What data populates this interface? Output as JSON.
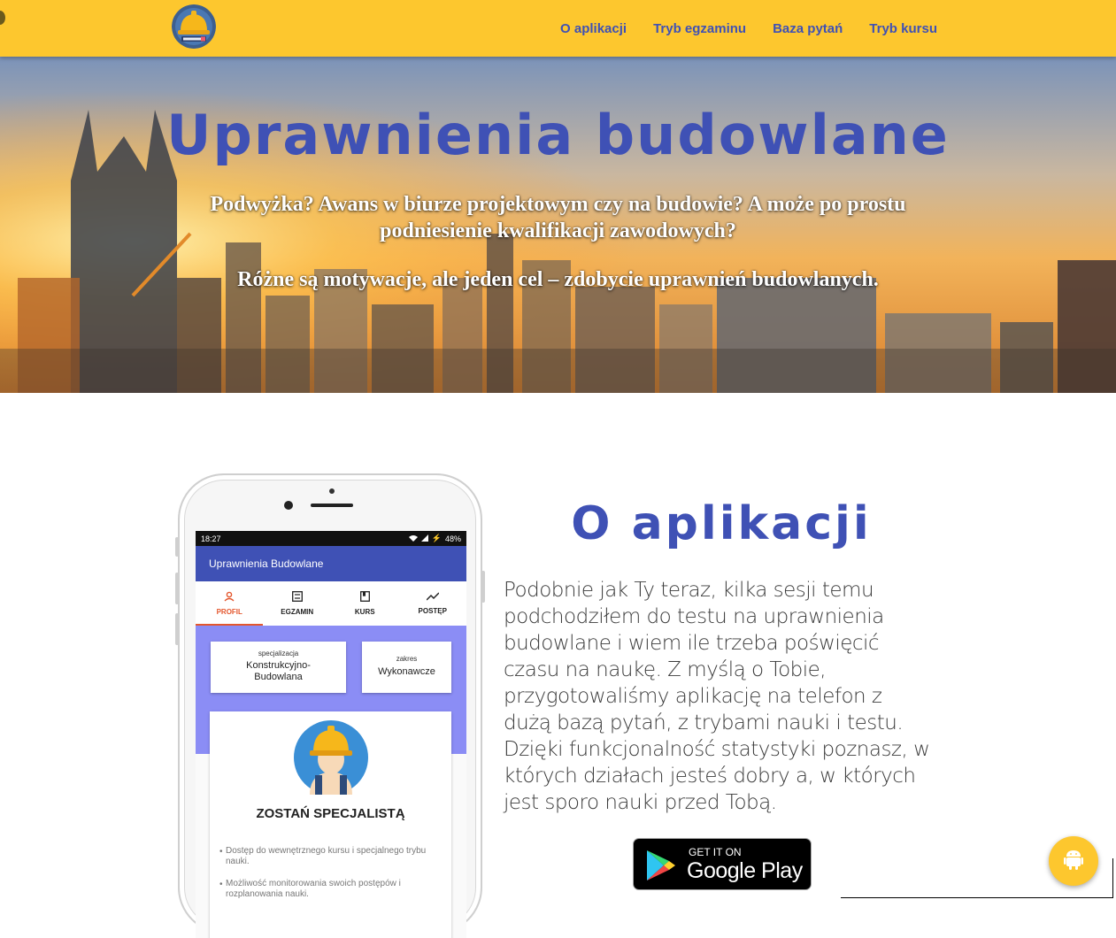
{
  "nav": {
    "items": [
      {
        "label": "O aplikacji"
      },
      {
        "label": "Tryb egzaminu"
      },
      {
        "label": "Baza pytań"
      },
      {
        "label": "Tryb kursu"
      }
    ]
  },
  "hero": {
    "title": "Uprawnienia budowlane",
    "subtitle1": "Podwyżka? Awans w biurze projektowym czy na budowie? A może po prostu podniesienie kwalifikacji zawodowych?",
    "subtitle2": "Różne są motywacje, ale jeden cel – zdobycie uprawnień budowlanych."
  },
  "phone": {
    "status_time": "18:27",
    "status_battery": "48%",
    "app_title": "Uprawnienia Budowlane",
    "tabs": [
      {
        "label": "PROFIL"
      },
      {
        "label": "EGZAMIN"
      },
      {
        "label": "KURS"
      },
      {
        "label": "POSTĘP"
      }
    ],
    "card_spec": {
      "small": "specjalizacja",
      "value": "Konstrukcyjno-Budowlana"
    },
    "card_range": {
      "small": "zakres",
      "value": "Wykonawcze"
    },
    "promo_title": "ZOSTAŃ SPECJALISTĄ",
    "promo_items": [
      "Dostęp do wewnętrznego kursu i specjalnego trybu nauki.",
      "Możliwość monitorowania swoich postępów i rozplanowania nauki."
    ]
  },
  "about": {
    "title": "O aplikacji",
    "text": "Podobnie jak Ty teraz, kilka sesji temu podchodziłem do testu na uprawnienia budowlane i wiem ile trzeba poświęcić czasu na naukę. Z myślą o Tobie, przygotowaliśmy aplikację na telefon z dużą bazą pytań, z trybami nauki i testu. Dzięki funkcjonalność statystyki poznasz, w których działach jesteś dobry a, w których jest sporo nauki przed Tobą."
  },
  "store_badge": {
    "line1": "GET IT ON",
    "line2": "Google Play"
  },
  "colors": {
    "accent": "#3f51b5",
    "header": "#fdc72e",
    "tab_active": "#e4572e"
  },
  "icons": {
    "logo": "hardhat-logo-icon",
    "fab": "android-icon",
    "store": "google-play-icon"
  }
}
